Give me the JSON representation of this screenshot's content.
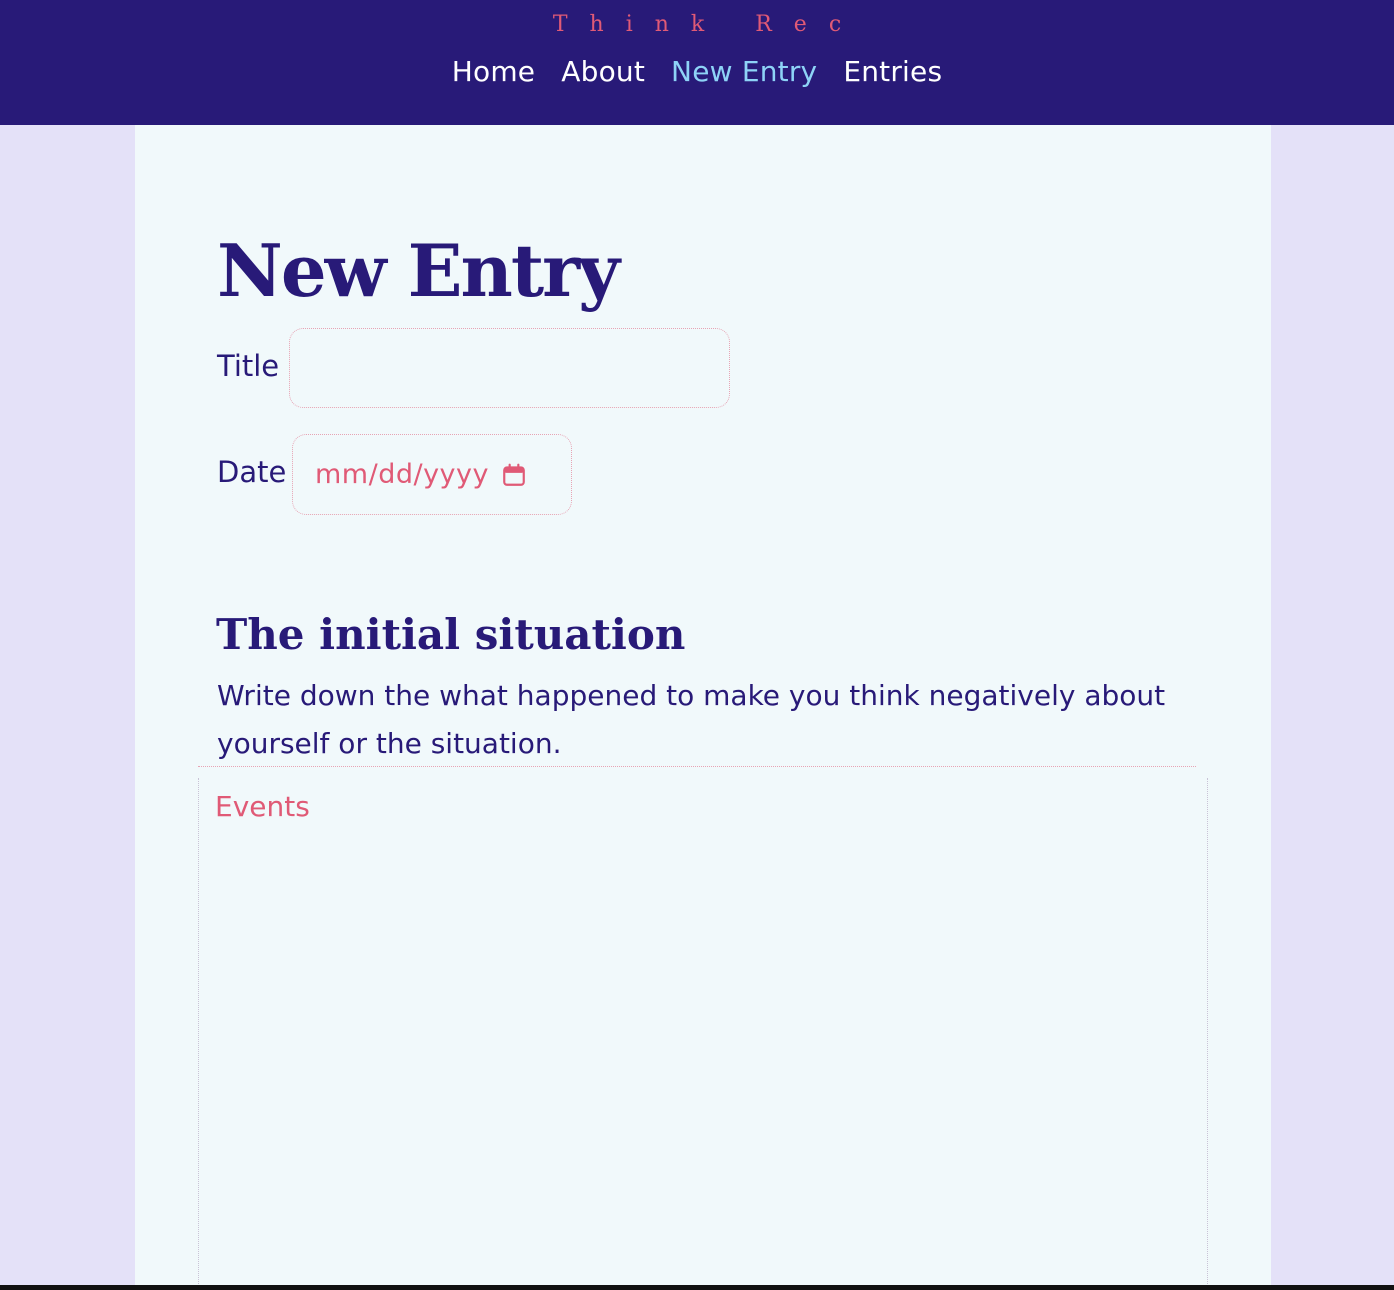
{
  "header": {
    "brand": "Think Rec",
    "nav": [
      {
        "label": "Home"
      },
      {
        "label": "About"
      },
      {
        "label": "New Entry",
        "active": true
      },
      {
        "label": "Entries"
      }
    ]
  },
  "form": {
    "page_title": "New Entry",
    "title_label": "Title",
    "title_value": "",
    "date_label": "Date",
    "date_placeholder": "mm/dd/yyyy",
    "date_icon": "calendar-icon"
  },
  "section": {
    "title": "The initial situation",
    "description": "Write down the what happened to make you think negatively about yourself or the situation.",
    "events_placeholder": "Events",
    "events_value": ""
  },
  "colors": {
    "header_bg": "#281a78",
    "page_bg": "#e4e1f8",
    "panel_bg": "#f1f9fb",
    "accent_pink": "#e05a76",
    "active_nav": "#8ed3f7",
    "text": "#281a78"
  }
}
